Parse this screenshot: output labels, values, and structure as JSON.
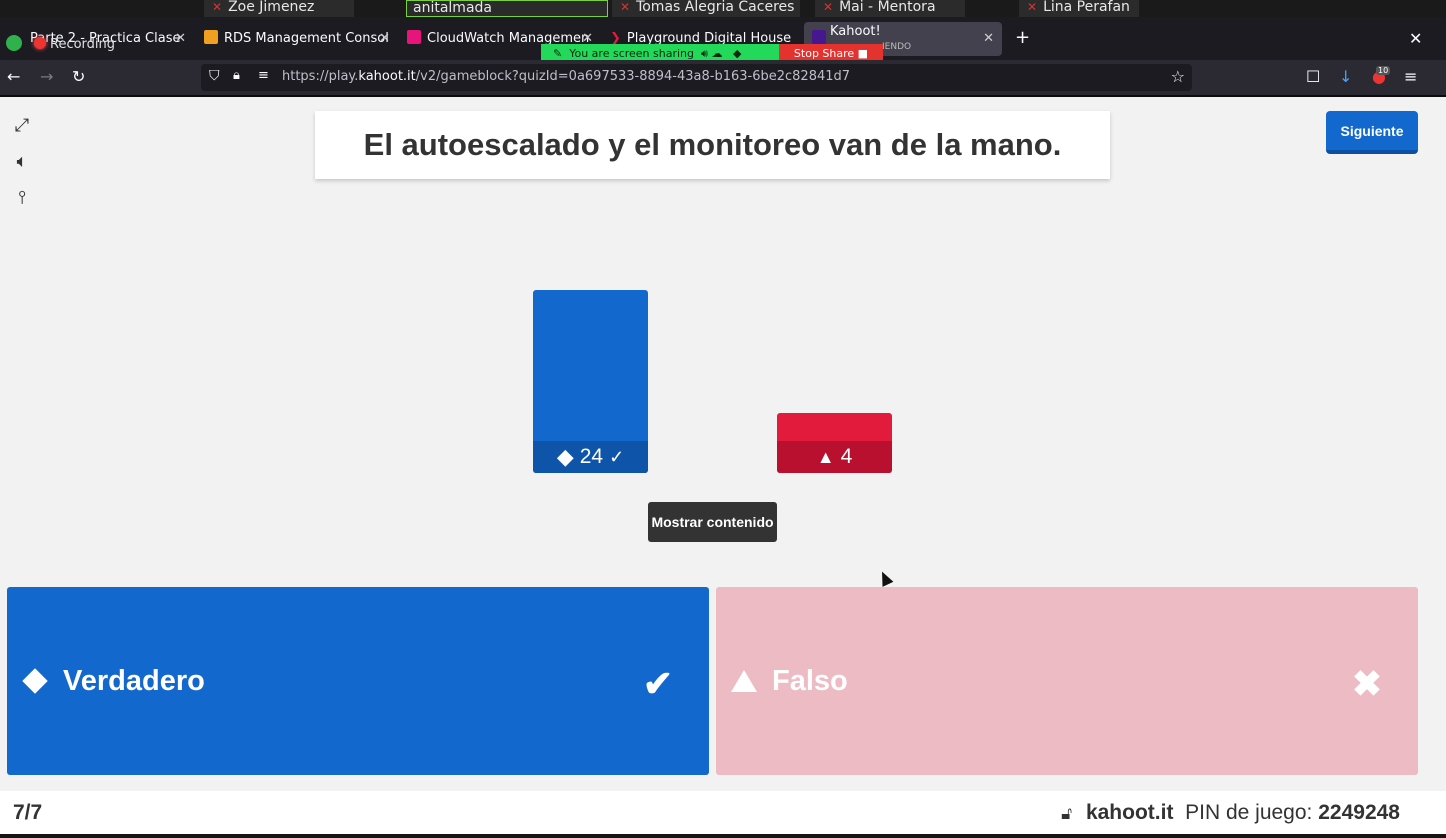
{
  "zoom": {
    "participants": [
      {
        "name": "Zoe Jimenez",
        "muted": true
      },
      {
        "name": "anitalmada",
        "muted": false
      },
      {
        "name": "Tomas Alegria Caceres",
        "muted": true
      },
      {
        "name": "Mai - Mentora",
        "muted": true
      },
      {
        "name": "Lina Perafan",
        "muted": true
      }
    ],
    "recording_label": "Recording",
    "screen_share": {
      "status": "You are screen sharing",
      "stop_label": "Stop Share"
    }
  },
  "browser": {
    "tabs": [
      {
        "title": "Parte 2 - Practica Clase",
        "icon_color": "#9aa0a6",
        "active": false
      },
      {
        "title": "RDS Management Consol",
        "icon_color": "#f0a020",
        "active": false
      },
      {
        "title": "CloudWatch Managemen",
        "icon_color": "#e7157b",
        "active": false
      },
      {
        "title": "Playground Digital House",
        "icon_color": "#e31b3b",
        "active": false
      },
      {
        "title": "Kahoot!",
        "subtitle": "IENDO",
        "icon_color": "#46178f",
        "active": true
      }
    ],
    "url": {
      "prefix": "https://play.",
      "domain": "kahoot.it",
      "path": "/v2/gameblock?quizId=0a697533-8894-43a8-b163-6be2c82841d7"
    },
    "extension_badge": "10"
  },
  "kahoot": {
    "question": "El autoescalado y el monitoreo van de la mano.",
    "next_label": "Siguiente",
    "show_content_label": "Mostrar contenido",
    "results": [
      {
        "answer": "Verdadero",
        "shape": "diamond",
        "count": 24,
        "correct": true,
        "color": "#1368ce",
        "label_color": "#0e54a8"
      },
      {
        "answer": "Falso",
        "shape": "triangle",
        "count": 4,
        "correct": false,
        "color": "#e21b3c",
        "label_color": "#b8102e"
      }
    ],
    "answers": [
      {
        "label": "Verdadero",
        "shape": "diamond",
        "correct": true,
        "color": "#1368ce"
      },
      {
        "label": "Falso",
        "shape": "triangle",
        "correct": false,
        "color": "#ecbbc4"
      }
    ],
    "footer": {
      "counter": "7/7",
      "site": "kahoot.it",
      "pin_label": "PIN de juego:",
      "pin": "2249248"
    }
  }
}
